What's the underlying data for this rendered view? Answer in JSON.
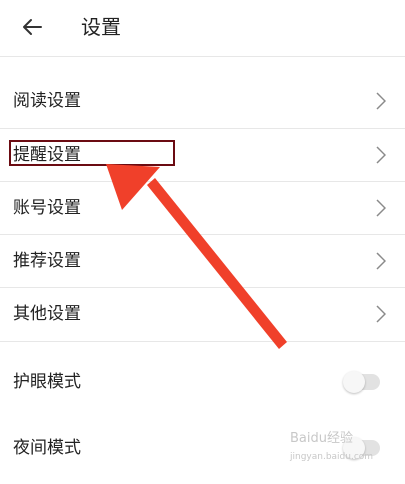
{
  "header": {
    "title": "设置",
    "back_icon": "arrow-left-icon"
  },
  "menu": {
    "items": [
      {
        "label": "阅读设置",
        "icon": "chevron-right-icon"
      },
      {
        "label": "提醒设置",
        "icon": "chevron-right-icon",
        "highlighted": true
      },
      {
        "label": "账号设置",
        "icon": "chevron-right-icon"
      },
      {
        "label": "推荐设置",
        "icon": "chevron-right-icon"
      },
      {
        "label": "其他设置",
        "icon": "chevron-right-icon"
      }
    ]
  },
  "toggles": [
    {
      "label": "护眼模式",
      "on": false
    },
    {
      "label": "夜间模式",
      "on": false
    }
  ],
  "annotation": {
    "highlight_color": "#6b0b12",
    "arrow_color": "#f0402a"
  },
  "watermark": {
    "text": "Baidu经验",
    "url": "jingyan.baidu.com"
  }
}
